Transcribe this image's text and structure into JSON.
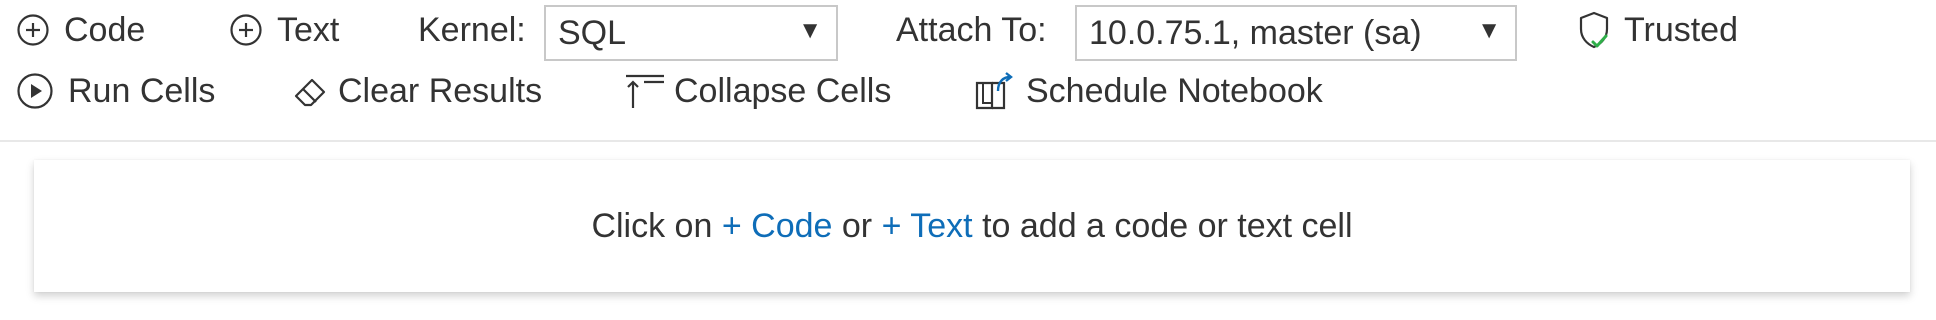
{
  "toolbar": {
    "add_code_label": "Code",
    "add_text_label": "Text",
    "kernel_label": "Kernel:",
    "kernel_value": "SQL",
    "attach_label": "Attach To:",
    "attach_value": "10.0.75.1, master (sa)",
    "trusted_label": "Trusted",
    "run_cells_label": "Run Cells",
    "clear_results_label": "Clear Results",
    "collapse_cells_label": "Collapse Cells",
    "schedule_label": "Schedule Notebook"
  },
  "empty_state": {
    "prefix": "Click on",
    "code_link": "+ Code",
    "or": "or",
    "text_link": "+ Text",
    "suffix": "to add a code or text cell"
  },
  "icons": {
    "add_code": "plus-circle-icon",
    "add_text": "plus-circle-icon",
    "trusted": "shield-check-icon",
    "run": "play-circle-icon",
    "clear": "eraser-icon",
    "collapse": "collapse-icon",
    "schedule": "schedule-book-icon",
    "dropdown": "chevron-down-icon"
  },
  "colors": {
    "link": "#0e6db8",
    "trusted_check": "#2fae49",
    "text": "#333333"
  }
}
